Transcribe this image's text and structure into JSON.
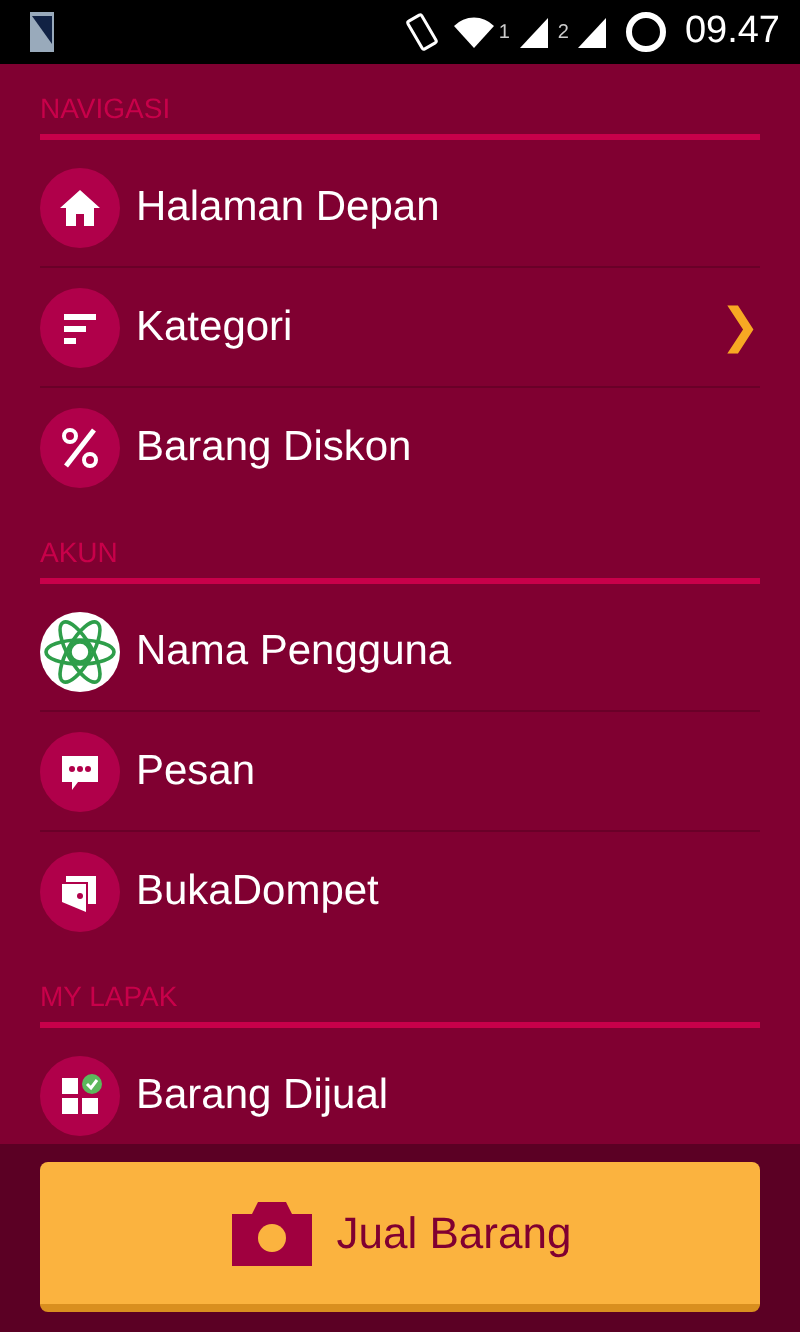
{
  "status_bar": {
    "sim_1": "1",
    "sim_2": "2",
    "time": "09.47"
  },
  "sections": [
    {
      "title": "NAVIGASI",
      "items": [
        {
          "kind": "home",
          "label": "Halaman Depan"
        },
        {
          "kind": "sort",
          "label": "Kategori",
          "arrow": "❯"
        },
        {
          "kind": "percent",
          "label": "Barang Diskon"
        }
      ]
    },
    {
      "title": "AKUN",
      "items": [
        {
          "kind": "avatar",
          "label": "Nama Pengguna"
        },
        {
          "kind": "chat",
          "label": "Pesan"
        },
        {
          "kind": "wallet",
          "label": "BukaDompet"
        }
      ]
    },
    {
      "title": "MY LAPAK",
      "items": [
        {
          "kind": "grid",
          "label": "Barang Dijual"
        }
      ]
    }
  ],
  "button": {
    "label": "Jual Barang"
  }
}
